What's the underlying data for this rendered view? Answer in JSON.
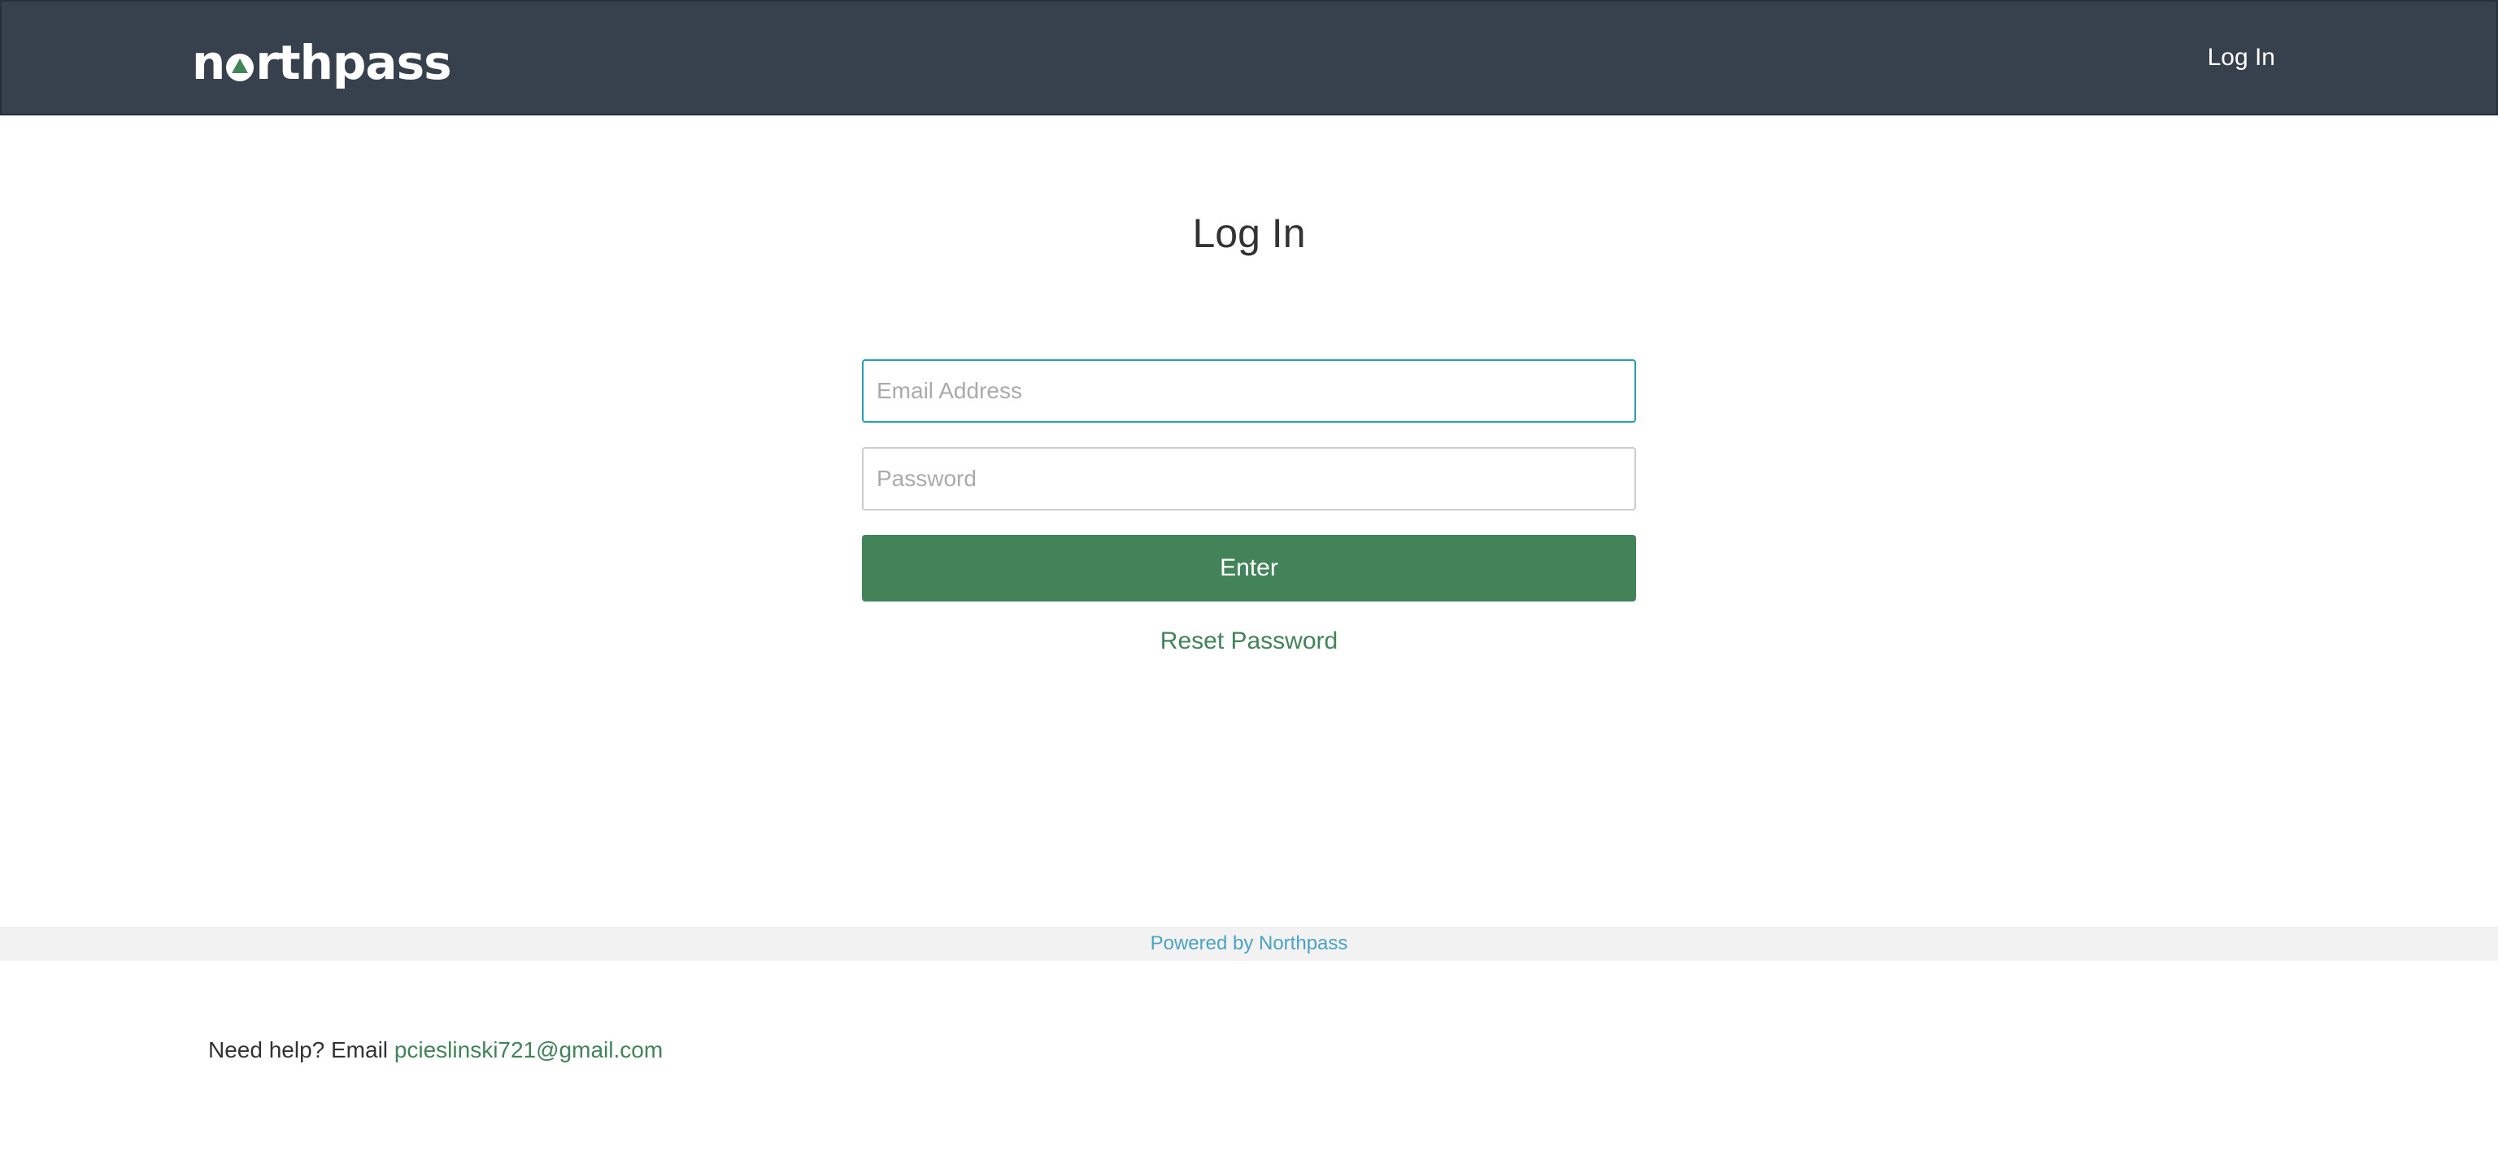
{
  "colors": {
    "header_bg": "#37414d",
    "accent": "#42835a",
    "focus_border": "#2a9bb6",
    "footer_link": "#4aa3c3"
  },
  "header": {
    "logo_text_left": "n",
    "logo_text_right": "rthpass",
    "logo_alt": "northpass",
    "login_link": "Log In"
  },
  "main": {
    "title": "Log In",
    "email_placeholder": "Email Address",
    "password_placeholder": "Password",
    "enter_label": "Enter",
    "reset_link": "Reset Password"
  },
  "footer": {
    "powered_by": "Powered by Northpass",
    "help_prefix": "Need help? Email",
    "help_email": "pcieslinski721@gmail.com"
  }
}
